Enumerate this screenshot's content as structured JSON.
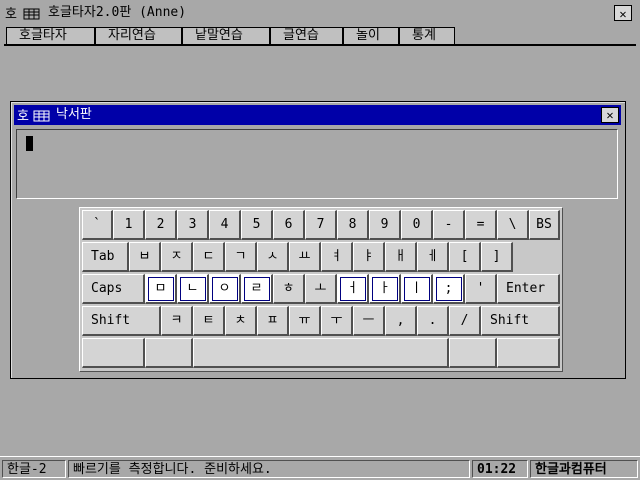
{
  "app": {
    "title": "호글타자2.0판 (Anne)",
    "close_glyph": "✕"
  },
  "menu": {
    "items": [
      {
        "label": "호글타자"
      },
      {
        "label": "자리연습"
      },
      {
        "label": "낱말연습"
      },
      {
        "label": "글연습"
      },
      {
        "label": "놀이"
      },
      {
        "label": "통계"
      }
    ]
  },
  "child_window": {
    "title": "낙서판",
    "close_glyph": "✕"
  },
  "keyboard": {
    "row1": [
      "`",
      "1",
      "2",
      "3",
      "4",
      "5",
      "6",
      "7",
      "8",
      "9",
      "0",
      "-",
      "=",
      "\\",
      "BS"
    ],
    "row2": [
      "Tab",
      "ㅂ",
      "ㅈ",
      "ㄷ",
      "ㄱ",
      "ㅅ",
      "ㅛ",
      "ㅕ",
      "ㅑ",
      "ㅐ",
      "ㅔ",
      "[",
      "]"
    ],
    "row3": [
      "Caps",
      "ㅁ",
      "ㄴ",
      "ㅇ",
      "ㄹ",
      "ㅎ",
      "ㅗ",
      "ㅓ",
      "ㅏ",
      "ㅣ",
      ";",
      "'",
      "Enter"
    ],
    "row4": [
      "Shift",
      "ㅋ",
      "ㅌ",
      "ㅊ",
      "ㅍ",
      "ㅠ",
      "ㅜ",
      "ㅡ",
      ",",
      ".",
      "/",
      "Shift"
    ],
    "row5": [
      "",
      "",
      "",
      "",
      ""
    ]
  },
  "status": {
    "mode": "한글-2",
    "message": "빠르기를 측정합니다. 준비하세요.",
    "time": "01:22",
    "company": "한글과컴퓨터"
  }
}
